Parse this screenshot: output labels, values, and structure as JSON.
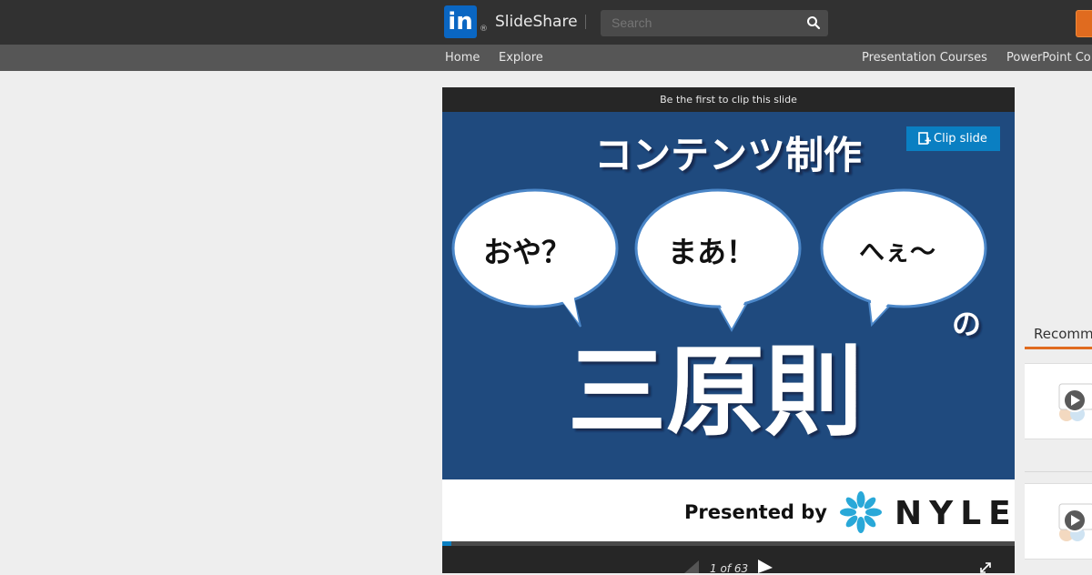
{
  "header": {
    "logo_text": "in",
    "logo_registered": "®",
    "brand": "SlideShare",
    "search_placeholder": "Search"
  },
  "nav": {
    "home": "Home",
    "explore": "Explore",
    "right_items": [
      "Presentation Courses",
      "PowerPoint Co"
    ]
  },
  "player": {
    "clip_hint": "Be the first to clip this slide",
    "clip_button": "Clip slide",
    "current_page": 1,
    "total_pages": 63,
    "page_indicator": "1 of 63",
    "progress_fraction": 0.016
  },
  "slide": {
    "title": "コンテンツ制作",
    "bubbles": [
      "おや？",
      "まあ！",
      "へぇ〜"
    ],
    "particle": "の",
    "main": "三原則",
    "presented_by": "Presented by",
    "company": "NYLE"
  },
  "sidebar": {
    "recommended_title": "Recommended"
  },
  "colors": {
    "topbar": "#313131",
    "accent": "#e06b1f",
    "linkedin_blue": "#0a66c2",
    "slide_blue": "#1f4a7e",
    "clip_blue": "#0a7fc2"
  }
}
